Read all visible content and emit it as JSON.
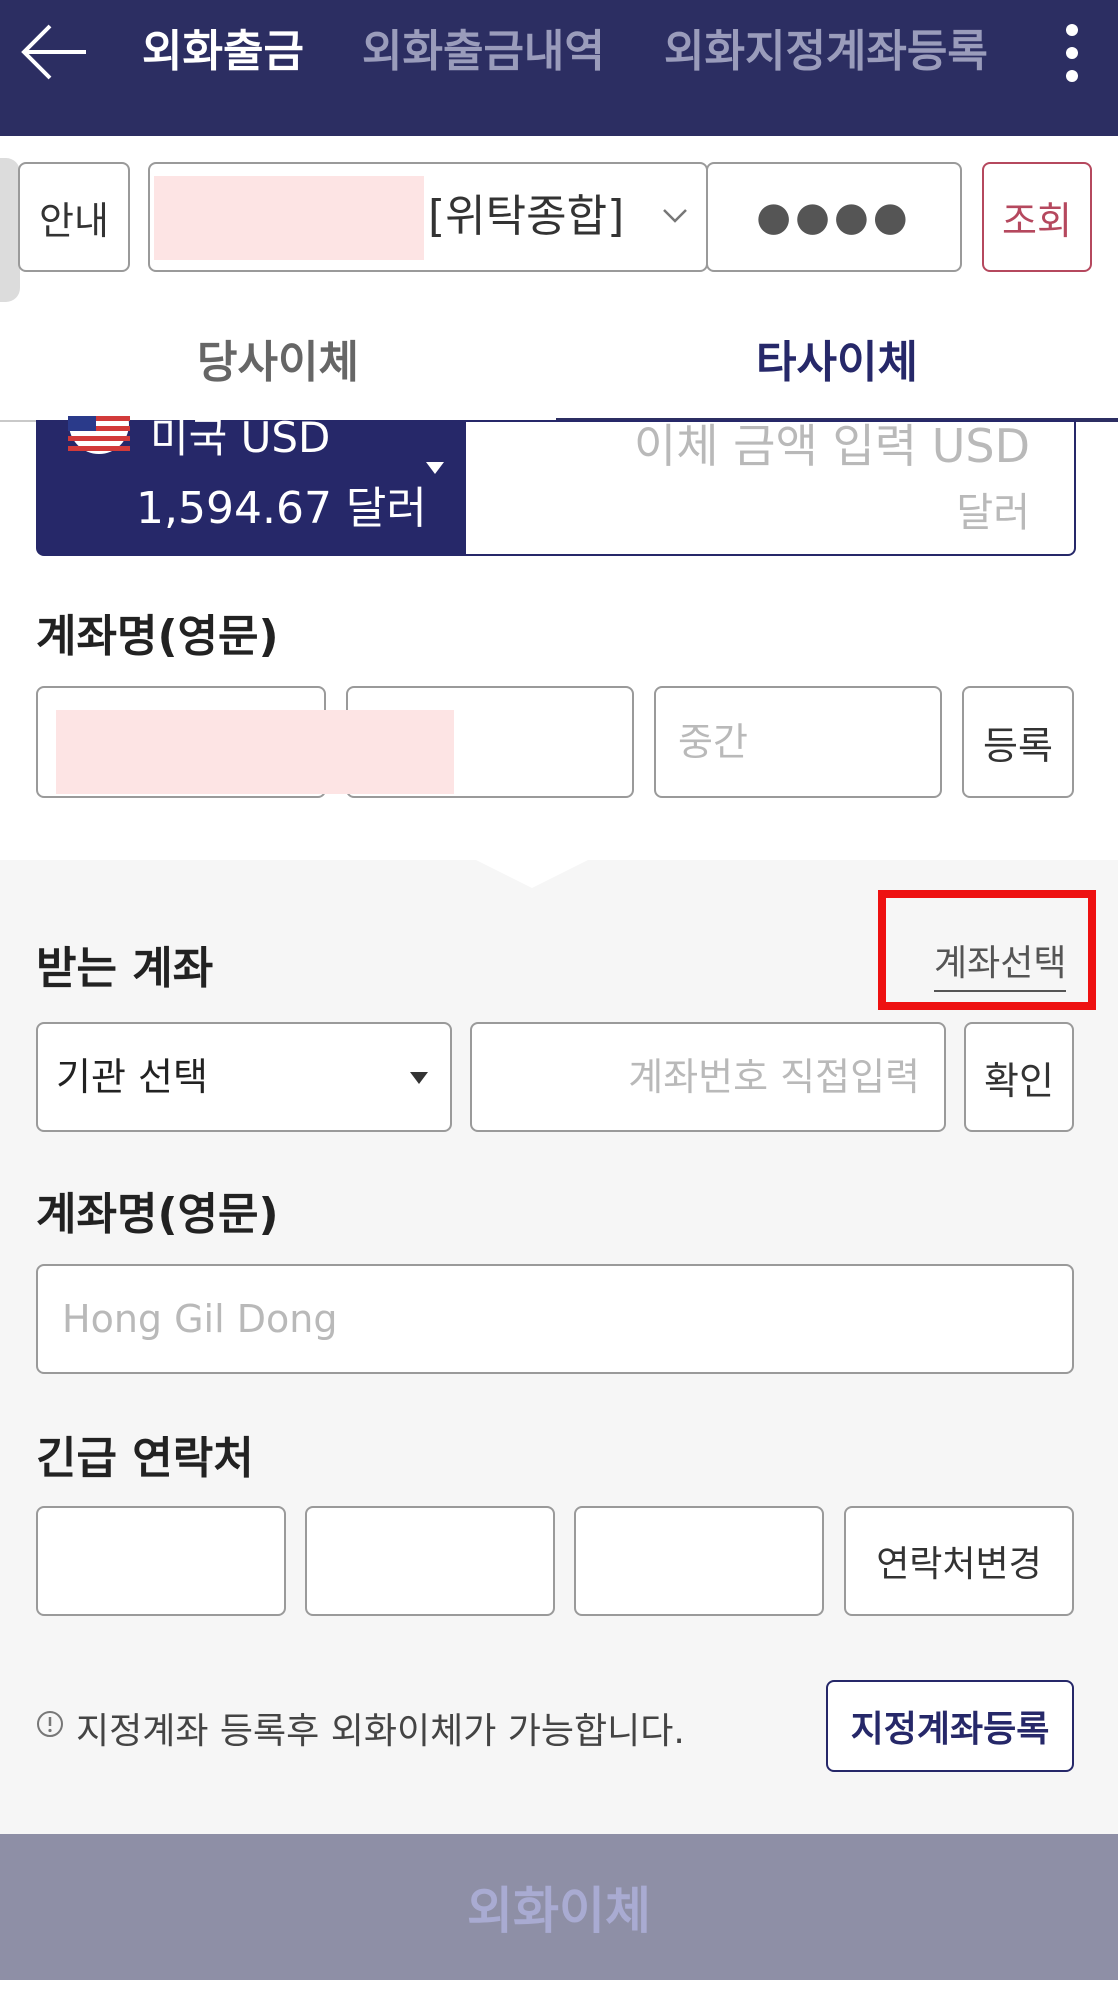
{
  "header": {
    "tabs": [
      {
        "label": "외화출금",
        "active": true
      },
      {
        "label": "외화출금내역",
        "active": false
      },
      {
        "label": "외화지정계좌등록",
        "active": false
      }
    ],
    "back_icon": "arrow-left-icon",
    "more_icon": "kebab-menu-icon",
    "bg_color": "#2c2e62"
  },
  "account_row": {
    "info_label": "안내",
    "account_type": "[위탁종합]",
    "password_mask": "●●●●",
    "query_label": "조회"
  },
  "subtabs": [
    {
      "label": "당사이체",
      "active": false
    },
    {
      "label": "타사이체",
      "active": true
    }
  ],
  "currency": {
    "name": "미국 USD",
    "balance": "1,594.67 달러",
    "amount_placeholder": "이체 금액 입력 USD",
    "unit": "달러"
  },
  "sender_name": {
    "label": "계좌명(영문)",
    "middle_placeholder": "중간",
    "register_label": "등록"
  },
  "receive_account": {
    "label": "받는 계좌",
    "select_account_link": "계좌선택",
    "institution_select": "기관 선택",
    "account_number_placeholder": "계좌번호 직접입력",
    "confirm_label": "확인"
  },
  "receiver_name": {
    "label": "계좌명(영문)",
    "placeholder": "Hong Gil Dong"
  },
  "emergency_contact": {
    "label": "긴급 연락처",
    "change_label": "연락처변경"
  },
  "notice": {
    "text": "지정계좌 등록후 외화이체가 가능합니다.",
    "register_designated_label": "지정계좌등록"
  },
  "submit_label": "외화이체"
}
